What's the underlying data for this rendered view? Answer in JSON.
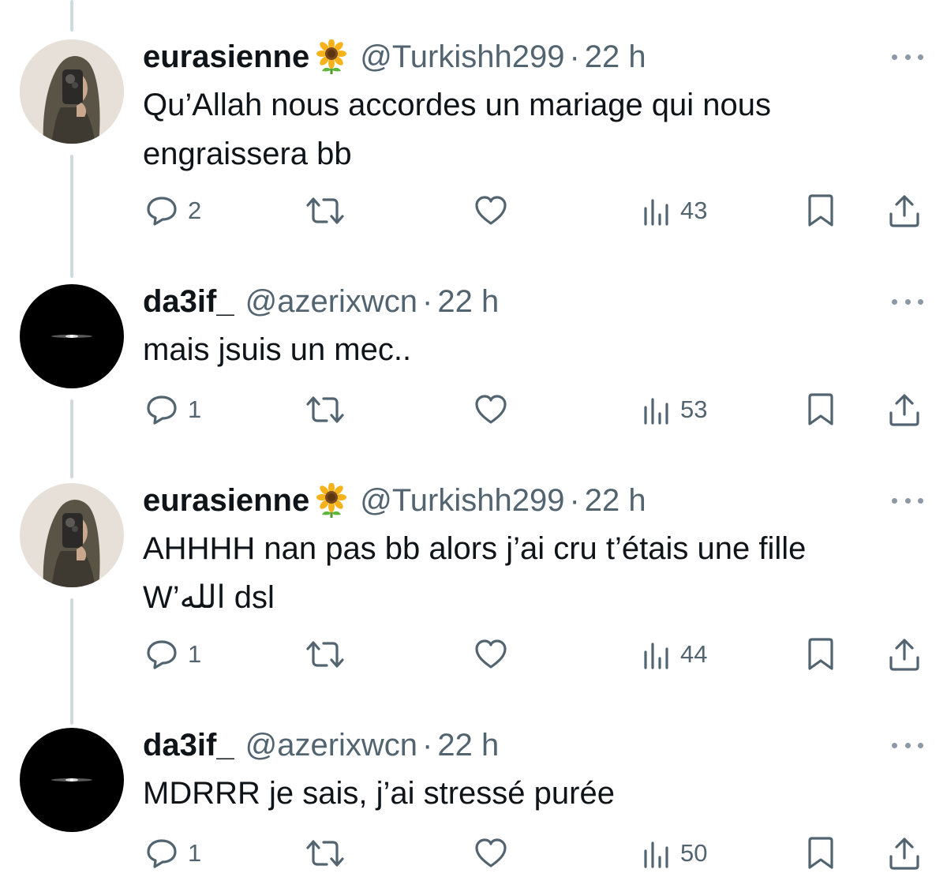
{
  "tweets": [
    {
      "display_name": "eurasienne",
      "has_emoji": true,
      "emoji_icon": "sunflower-icon",
      "handle": "@Turkishh299",
      "separator": "·",
      "time": "22 h",
      "text_lines": [
        "Qu’Allah nous accordes un mariage qui nous",
        "engraissera bb"
      ],
      "replies": "2",
      "views": "43"
    },
    {
      "display_name": "da3if_",
      "has_emoji": false,
      "handle": "@azerixwcn",
      "separator": "·",
      "time": "22 h",
      "text_lines": [
        "mais jsuis un mec.."
      ],
      "replies": "1",
      "views": "53"
    },
    {
      "display_name": "eurasienne",
      "has_emoji": true,
      "emoji_icon": "sunflower-icon",
      "handle": "@Turkishh299",
      "separator": "·",
      "time": "22 h",
      "text_lines": [
        "AHHHH nan pas bb alors j’ai cru t’étais une fille",
        "W’الله dsl"
      ],
      "replies": "1",
      "views": "44"
    },
    {
      "display_name": "da3if_",
      "has_emoji": false,
      "handle": "@azerixwcn",
      "separator": "·",
      "time": "22 h",
      "text_lines": [
        "MDRRR je sais, j’ai stressé purée"
      ],
      "replies": "1",
      "views": "50"
    }
  ],
  "colors": {
    "text": "#0f1419",
    "secondary": "#536471",
    "thread_line": "#cfd9de",
    "background": "#ffffff"
  }
}
